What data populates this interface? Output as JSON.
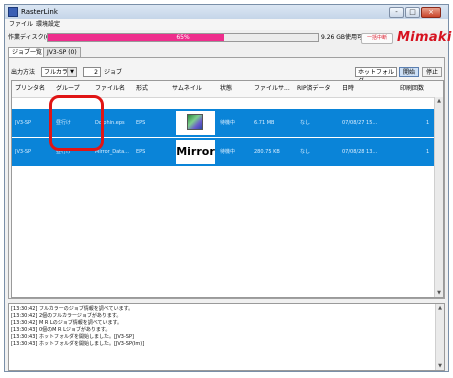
{
  "window": {
    "title": "RasterLink",
    "buttons": {
      "minimize": "-",
      "maximize": "□",
      "close": "×"
    }
  },
  "menu": {
    "items": [
      "ファイル",
      "環境設定"
    ]
  },
  "disk": {
    "label": "作業ディスク(C:)",
    "percent_text": "65%",
    "fill_fraction": 0.65,
    "usage": "9.26 GB使用可能",
    "pause_label": "一括中断",
    "fill_color": "#ee2d8c"
  },
  "brand": {
    "logo": "Mimaki"
  },
  "tabs": [
    {
      "label": "ジョブ一覧"
    },
    {
      "label": "JV3-SP (0)"
    }
  ],
  "toolbar": {
    "output_label": "出力方法",
    "output_value": "フルカラー",
    "job_count": "2",
    "job_unit": "ジョブ",
    "hot_folder_label": "ホットフォルダ",
    "start_label": "開始",
    "stop_label": "停止"
  },
  "table": {
    "columns": [
      "プリンタ名",
      "グループ",
      "ファイル名",
      "形式",
      "サムネイル",
      "状態",
      "ファイルサ...",
      "RIP済データ",
      "日時",
      "印刷回数"
    ],
    "rows": [
      {
        "printer": "JV3-SP",
        "group": "昼行け",
        "file": "Dolphin.eps",
        "format": "EPS",
        "thumb": "image",
        "status": "待機中",
        "size": "6.71 MB",
        "rip": "なし",
        "date": "07/08/27 15...",
        "count": "1"
      },
      {
        "printer": "JV3-SP",
        "group": "昼行け",
        "file": "Mirror_Data...",
        "format": "EPS",
        "thumb": "Mirror",
        "status": "待機中",
        "size": "280.75 KB",
        "rip": "なし",
        "date": "07/08/28 13...",
        "count": "1"
      }
    ]
  },
  "log": {
    "lines": [
      "[13:30:42] フルカラーのジョブ情報を調べています。",
      "[13:30:42] 2個のフルカラージョブがあります。",
      "[13:30:42] M R Lのジョブ情報を調べています。",
      "[13:30:43] 0個のM R Lジョブがあります。",
      "[13:30:43] ホットフォルダを開始しました。[JV3-SP]",
      "[13:30:43] ホットフォルダを開始しました。[JV3-SP(Im)]"
    ]
  }
}
